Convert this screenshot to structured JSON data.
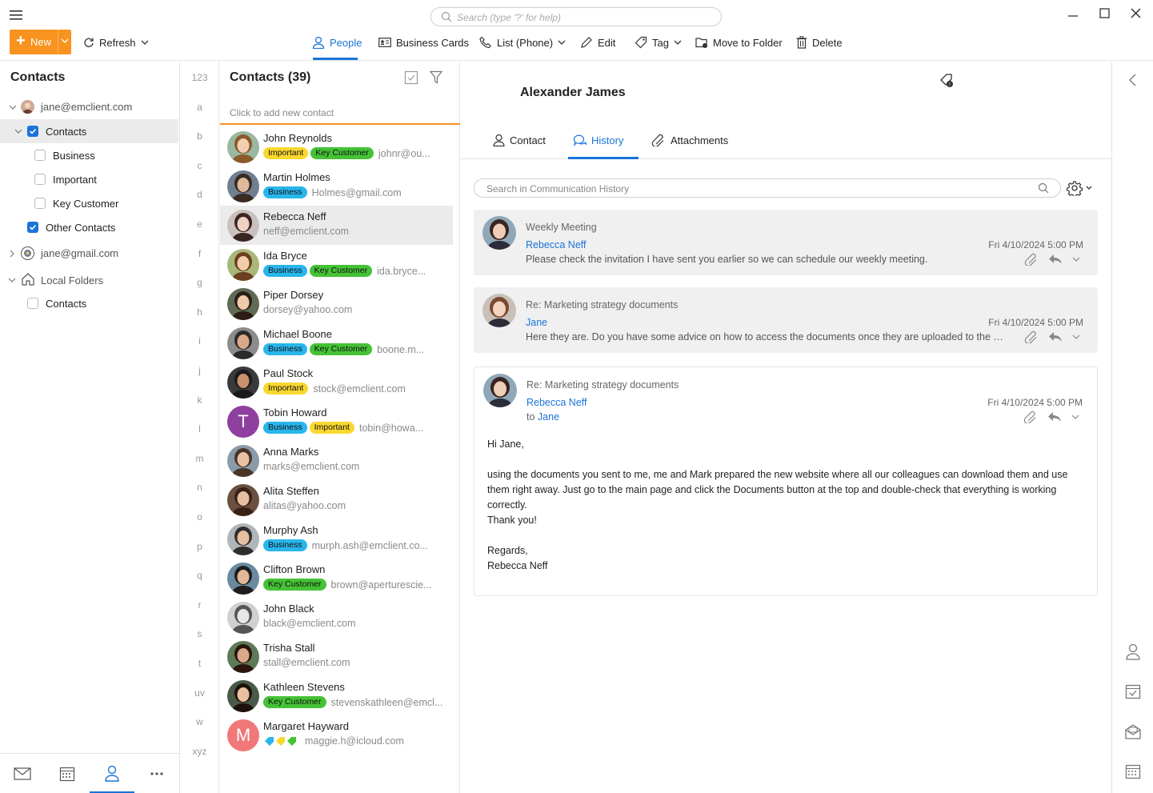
{
  "search": {
    "placeholder": "Search (type '?' for help)"
  },
  "toolbar": {
    "new_label": "New",
    "refresh_label": "Refresh",
    "people_label": "People",
    "business_cards_label": "Business Cards",
    "list_label": "List (Phone)",
    "edit_label": "Edit",
    "tag_label": "Tag",
    "move_label": "Move to Folder",
    "delete_label": "Delete"
  },
  "sidebar": {
    "title": "Contacts",
    "items": [
      {
        "label": "jane@emclient.com"
      },
      {
        "label": "Contacts"
      },
      {
        "label": "Business"
      },
      {
        "label": "Important"
      },
      {
        "label": "Key Customer"
      },
      {
        "label": "Other Contacts"
      },
      {
        "label": "jane@gmail.com"
      },
      {
        "label": "Local Folders"
      },
      {
        "label": "Contacts"
      }
    ]
  },
  "alphabet": [
    "123",
    "a",
    "b",
    "c",
    "d",
    "e",
    "f",
    "g",
    "h",
    "i",
    "j",
    "k",
    "l",
    "m",
    "n",
    "o",
    "p",
    "q",
    "r",
    "s",
    "t",
    "uv",
    "w",
    "xyz"
  ],
  "contact_list": {
    "title": "Contacts (39)",
    "add_hint": "Click to add new contact",
    "contacts": [
      {
        "name": "John Reynolds",
        "tags": [
          "Important",
          "Key Customer"
        ],
        "email": "johnr@ou..."
      },
      {
        "name": "Martin Holmes",
        "tags": [
          "Business"
        ],
        "email": "Holmes@gmail.com"
      },
      {
        "name": "Rebecca Neff",
        "tags": [],
        "email": "neff@emclient.com"
      },
      {
        "name": "Ida Bryce",
        "tags": [
          "Business",
          "Key Customer"
        ],
        "email": "ida.bryce..."
      },
      {
        "name": "Piper Dorsey",
        "tags": [],
        "email": "dorsey@yahoo.com"
      },
      {
        "name": "Michael Boone",
        "tags": [
          "Business",
          "Key Customer"
        ],
        "email": "boone.m..."
      },
      {
        "name": "Paul Stock",
        "tags": [
          "Important"
        ],
        "email": "stock@emclient.com"
      },
      {
        "name": "Tobin Howard",
        "tags": [
          "Business",
          "Important"
        ],
        "email": "tobin@howa...",
        "initial": "T"
      },
      {
        "name": "Anna Marks",
        "tags": [],
        "email": "marks@emclient.com"
      },
      {
        "name": "Alita Steffen",
        "tags": [],
        "email": "alitas@yahoo.com"
      },
      {
        "name": "Murphy Ash",
        "tags": [
          "Business"
        ],
        "email": "murph.ash@emclient.co..."
      },
      {
        "name": "Clifton Brown",
        "tags": [
          "Key Customer"
        ],
        "email": "brown@aperturescie..."
      },
      {
        "name": "John Black",
        "tags": [],
        "email": "black@emclient.com"
      },
      {
        "name": "Trisha Stall",
        "tags": [],
        "email": "stall@emclient.com"
      },
      {
        "name": "Kathleen Stevens",
        "tags": [
          "Key Customer"
        ],
        "email": "stevenskathleen@emcl..."
      },
      {
        "name": "Margaret Hayward",
        "tags": [],
        "email": "maggie.h@icloud.com",
        "initial": "M"
      }
    ]
  },
  "detail": {
    "name": "Alexander James",
    "tabs": {
      "contact": "Contact",
      "history": "History",
      "attachments": "Attachments"
    },
    "history_search_placeholder": "Search in Communication History",
    "messages": [
      {
        "subject": "Weekly Meeting",
        "sender": "Rebecca Neff",
        "date": "Fri 4/10/2024 5:00 PM",
        "preview": "Please check the invitation I have sent you earlier so we can schedule our weekly meeting."
      },
      {
        "subject": "Re: Marketing strategy documents",
        "sender": "Jane",
        "date": "Fri 4/10/2024 5:00 PM",
        "preview": "Here they are. Do you have some advice on how to access the documents once they are uploaded to the new..."
      },
      {
        "subject": "Re: Marketing strategy documents",
        "sender": "Rebecca Neff",
        "date": "Fri 4/10/2024 5:00 PM",
        "to_prefix": "to",
        "to": "Jane",
        "body": {
          "greeting": "Hi Jane,",
          "paragraph": "using the documents you sent to me, me and Mark prepared the new website where all our colleagues can download them and use them right away. Just go to the main page and click the Documents button at the top and double-check that everything is working correctly.",
          "thanks": "Thank you!",
          "regards": "Regards,",
          "signature": "Rebecca Neff"
        }
      }
    ]
  },
  "colors": {
    "accent": "#1a73d9",
    "new_button": "#f7931e",
    "business": "#28b6ec",
    "important": "#f9d82e",
    "key_customer": "#45c236"
  }
}
